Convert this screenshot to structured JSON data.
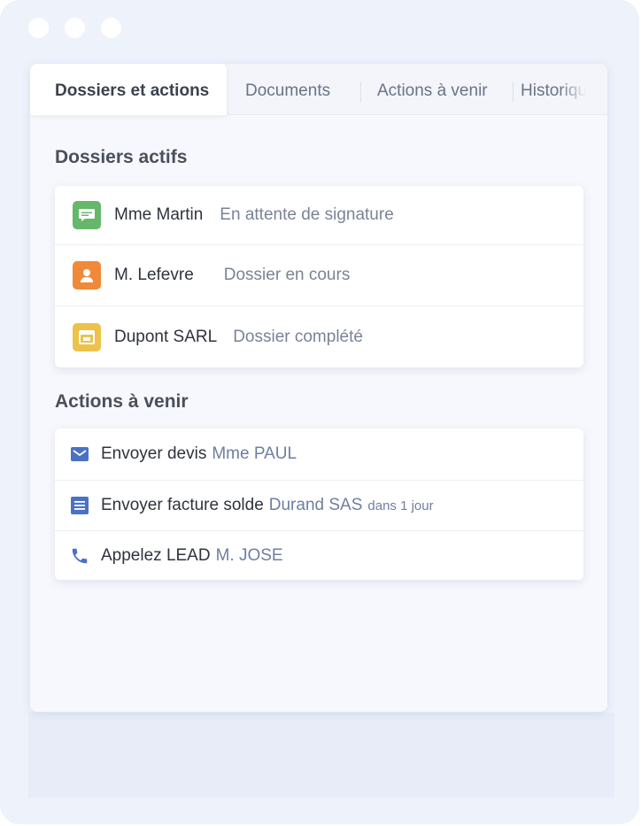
{
  "tabs": [
    {
      "label": "Dossiers et actions",
      "active": true
    },
    {
      "label": "Documents"
    },
    {
      "label": "Actions à venir"
    },
    {
      "label": "Historique"
    }
  ],
  "dossiers": {
    "title": "Dossiers actifs",
    "items": [
      {
        "name": "Mme Martin",
        "status": "En attente de signature",
        "icon": "message-icon",
        "color": "#67b76b"
      },
      {
        "name": "M. Lefevre",
        "status": "Dossier en cours",
        "icon": "user-icon",
        "color": "#f0893a"
      },
      {
        "name": "Dupont SARL",
        "status": "Dossier complété",
        "icon": "building-icon",
        "color": "#ecc24a"
      }
    ]
  },
  "actions": {
    "title": "Actions à venir",
    "items": [
      {
        "label": "Envoyer devis",
        "who": "Mme PAUL",
        "when": "",
        "icon": "envelope-icon"
      },
      {
        "label": "Envoyer facture solde",
        "who": "Durand SAS",
        "when": "dans 1 jour",
        "icon": "document-icon"
      },
      {
        "label": "Appelez LEAD",
        "who": "M. JOSE",
        "when": "",
        "icon": "phone-icon"
      }
    ],
    "icon_color": "#4a72c4"
  }
}
